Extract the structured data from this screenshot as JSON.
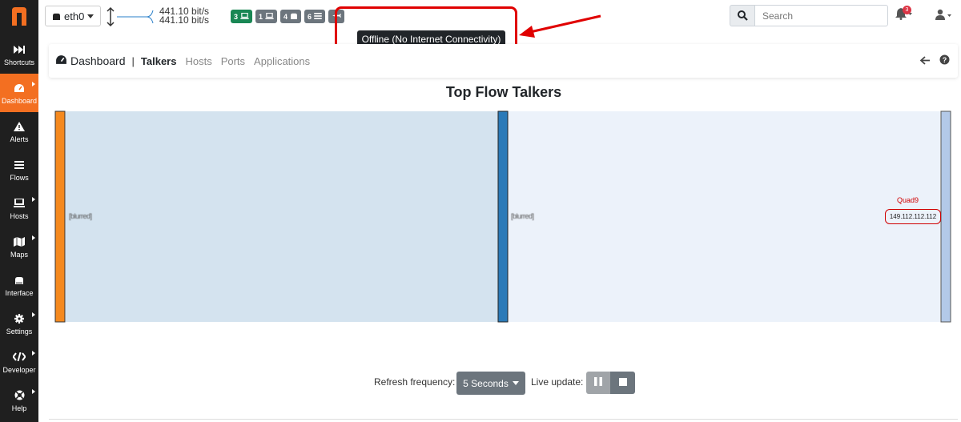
{
  "sidebar": {
    "items": [
      {
        "label": "Shortcuts",
        "icon": "fast-forward-icon"
      },
      {
        "label": "Dashboard",
        "icon": "gauge-icon"
      },
      {
        "label": "Alerts",
        "icon": "warning-icon"
      },
      {
        "label": "Flows",
        "icon": "list-icon"
      },
      {
        "label": "Hosts",
        "icon": "laptop-icon"
      },
      {
        "label": "Maps",
        "icon": "map-icon"
      },
      {
        "label": "Interface",
        "icon": "ethernet-icon"
      },
      {
        "label": "Settings",
        "icon": "gear-icon"
      },
      {
        "label": "Developer",
        "icon": "code-icon"
      },
      {
        "label": "Help",
        "icon": "lifebuoy-icon"
      }
    ],
    "active": "Dashboard",
    "accent": "#f36f21"
  },
  "topbar": {
    "interface": "eth0",
    "speed_up": "441.10 bit/s",
    "speed_down": "441.10 bit/s",
    "badges": [
      {
        "count": "3",
        "icon": "laptop-icon",
        "color": "#198754"
      },
      {
        "count": "1",
        "icon": "laptop-icon",
        "color": "#6c757d"
      },
      {
        "count": "4",
        "icon": "ethernet-icon",
        "color": "#6c757d"
      },
      {
        "count": "6",
        "icon": "list-icon",
        "color": "#6c757d"
      },
      {
        "count": "",
        "icon": "plane-icon",
        "color": "#6c757d"
      }
    ],
    "tooltip": "Offline (No Internet Connectivity)",
    "search_placeholder": "Search",
    "notifications": "3"
  },
  "breadcrumb": {
    "title": "Dashboard",
    "separator": "|",
    "tabs": [
      "Talkers",
      "Hosts",
      "Ports",
      "Applications"
    ],
    "active_tab": "Talkers"
  },
  "main": {
    "title": "Top Flow Talkers",
    "sankey": {
      "left_label": "[blurred]",
      "middle_label": "[blurred]",
      "right_name": "Quad9",
      "right_ip": "149.112.112.112"
    }
  },
  "footer": {
    "refresh_label": "Refresh frequency:",
    "refresh_value": "5 Seconds",
    "live_label": "Live update:"
  }
}
